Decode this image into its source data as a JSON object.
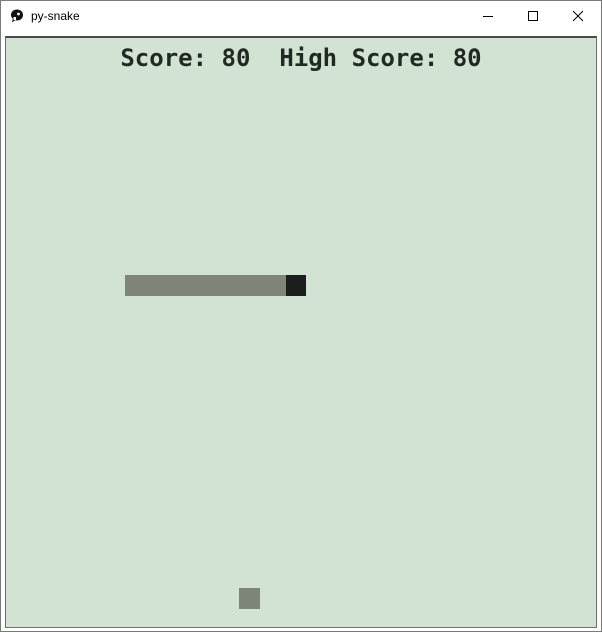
{
  "window": {
    "title": "py-snake",
    "controls": {
      "minimize_icon": "minimize-icon",
      "maximize_icon": "maximize-icon",
      "close_icon": "close-icon"
    }
  },
  "hud": {
    "score_label": "Score:",
    "score_value": "80",
    "high_score_label": "High Score:",
    "high_score_value": "80"
  },
  "game": {
    "snake_length_segments": 9,
    "direction": "right",
    "colors": {
      "background": "#d3e3d3",
      "snake_body": "#7f8577",
      "snake_head": "#1b1e1c",
      "food": "#7f8577",
      "text": "#1e2a22"
    }
  }
}
